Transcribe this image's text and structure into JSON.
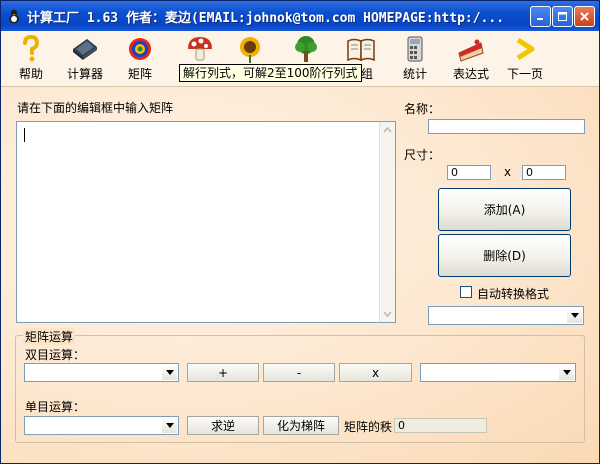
{
  "window": {
    "title": "计算工厂 1.63 作者：麦边(EMAIL:johnok@tom.com HOMEPAGE:http:/...",
    "colors": {
      "titlebar": "#0a4fcf",
      "background": "#fce6cc",
      "close": "#c8421c"
    }
  },
  "toolbar": {
    "items": [
      {
        "label": "帮助",
        "icon": "question-icon"
      },
      {
        "label": "计算器",
        "icon": "laptop-icon"
      },
      {
        "label": "矩阵",
        "icon": "tie-dye-icon"
      },
      {
        "label": "",
        "icon": "mushroom-icon"
      },
      {
        "label": "",
        "icon": "sunflower-icon"
      },
      {
        "label": "",
        "icon": "tree-icon"
      },
      {
        "label": "程组",
        "icon": "book-icon"
      },
      {
        "label": "统计",
        "icon": "calculator-icon"
      },
      {
        "label": "表达式",
        "icon": "cake-icon"
      },
      {
        "label": "下一页",
        "icon": "next-arrow-icon"
      }
    ],
    "tooltip": "解行列式，可解2至100阶行列式"
  },
  "editor": {
    "prompt": "请在下面的编辑框中输入矩阵",
    "value": ""
  },
  "name": {
    "label": "名称：",
    "value": ""
  },
  "size": {
    "label": "尺寸：",
    "rows": "0",
    "sep": "x",
    "cols": "0"
  },
  "buttons": {
    "add": "添加(A)",
    "delete": "删除(D)"
  },
  "autoconvert": {
    "label": "自动转换格式",
    "checked": false
  },
  "ops": {
    "group": "矩阵运算",
    "binary_label": "双目运算：",
    "plus": "+",
    "minus": "-",
    "times": "x",
    "unary_label": "单目运算：",
    "inverse": "求逆",
    "echelon": "化为梯阵",
    "rank_label": "矩阵的秩",
    "rank_value": "0"
  }
}
